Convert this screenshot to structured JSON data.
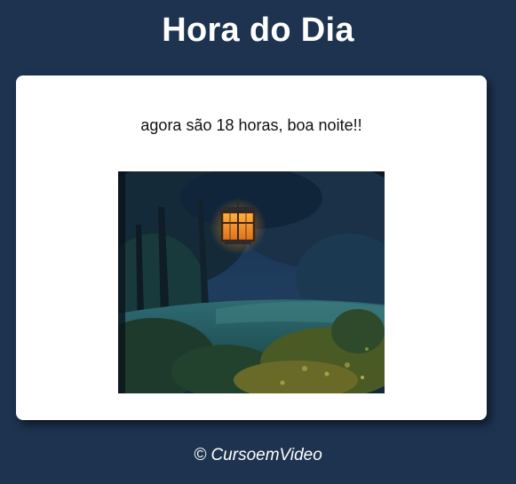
{
  "header": {
    "title": "Hora do Dia"
  },
  "main": {
    "message": "agora são 18 horas, boa noite!!",
    "image": {
      "subject": "night garden with lit lantern"
    }
  },
  "footer": {
    "copyright": "© CursoemVideo"
  },
  "colors": {
    "background": "#1d3350",
    "card": "#ffffff",
    "lantern_glow": "#f59a1e"
  }
}
